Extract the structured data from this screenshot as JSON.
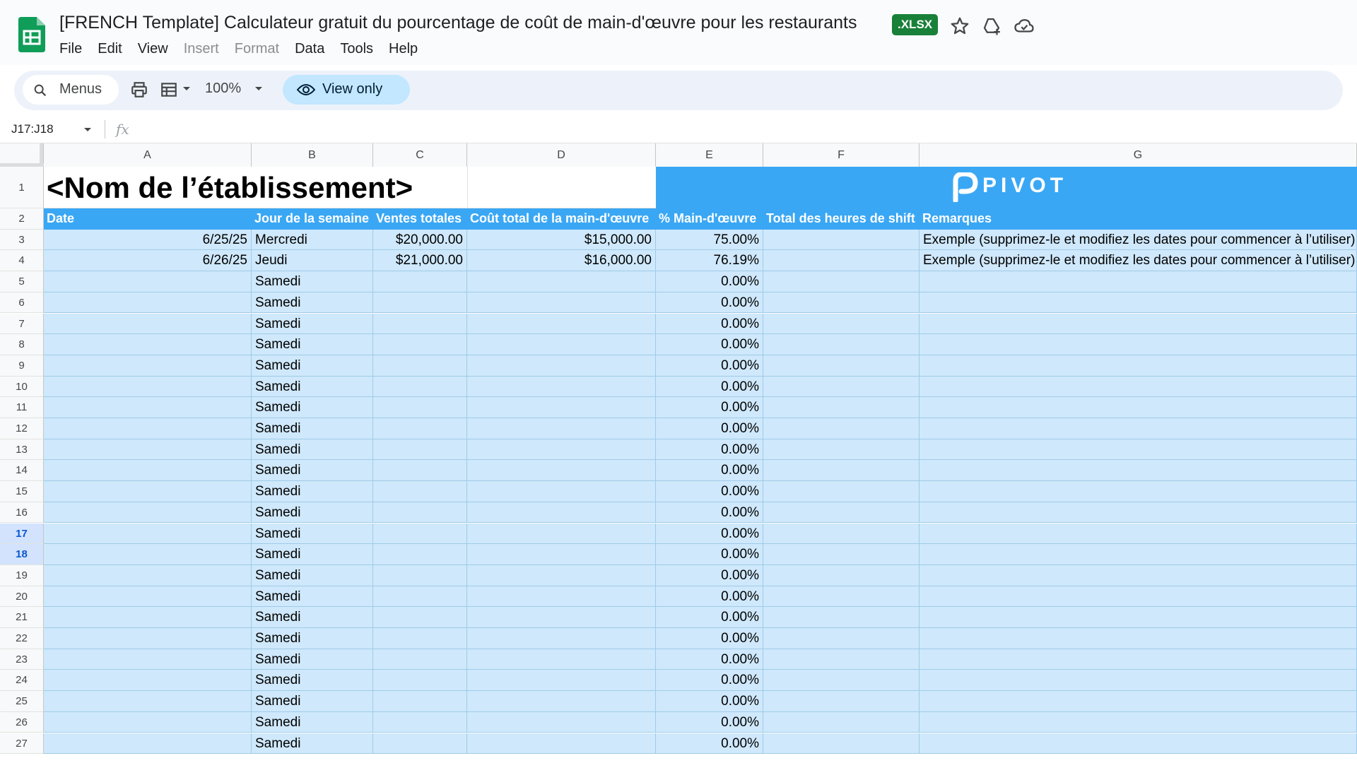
{
  "document": {
    "title": "[FRENCH Template] Calculateur gratuit du pourcentage de coût de main-d'œuvre pour les restaurants",
    "badge": ".XLSX"
  },
  "icons": {
    "app": "sheets-icon",
    "star": "star-icon",
    "move_to_drive": "drive-add-icon",
    "cloud": "cloud-status-icon"
  },
  "menu": [
    "File",
    "Edit",
    "View",
    "Insert",
    "Format",
    "Data",
    "Tools",
    "Help"
  ],
  "menu_disabled": [
    "Insert",
    "Format"
  ],
  "toolbar": {
    "search_label": "Menus",
    "zoom": "100%",
    "view_only_label": "View only"
  },
  "formula_bar": {
    "name_box": "J17:J18",
    "fx": "fx"
  },
  "columns": [
    "A",
    "B",
    "C",
    "D",
    "E",
    "F",
    "G"
  ],
  "sheet": {
    "establishment_name": "<Nom de l’établissement>",
    "brand_name": "PIVOT",
    "headers": [
      "Date",
      "Jour de la semaine",
      "Ventes totales",
      "Coût total de la main-d'œuvre",
      "% Main-d'œuvre",
      "Total des heures de shift",
      "Remarques"
    ],
    "rows": [
      {
        "row": "3",
        "date": "6/25/25",
        "day": "Mercredi",
        "sales": "$20,000.00",
        "labor": "$15,000.00",
        "pct": "75.00%",
        "hours": "",
        "notes": "Exemple (supprimez-le et modifiez les dates pour commencer à l’utiliser)"
      },
      {
        "row": "4",
        "date": "6/26/25",
        "day": "Jeudi",
        "sales": "$21,000.00",
        "labor": "$16,000.00",
        "pct": "76.19%",
        "hours": "",
        "notes": "Exemple (supprimez-le et modifiez les dates pour commencer à l’utiliser)"
      },
      {
        "row": "5",
        "date": "",
        "day": "Samedi",
        "sales": "",
        "labor": "",
        "pct": "0.00%",
        "hours": "",
        "notes": ""
      },
      {
        "row": "6",
        "date": "",
        "day": "Samedi",
        "sales": "",
        "labor": "",
        "pct": "0.00%",
        "hours": "",
        "notes": ""
      },
      {
        "row": "7",
        "date": "",
        "day": "Samedi",
        "sales": "",
        "labor": "",
        "pct": "0.00%",
        "hours": "",
        "notes": ""
      },
      {
        "row": "8",
        "date": "",
        "day": "Samedi",
        "sales": "",
        "labor": "",
        "pct": "0.00%",
        "hours": "",
        "notes": ""
      },
      {
        "row": "9",
        "date": "",
        "day": "Samedi",
        "sales": "",
        "labor": "",
        "pct": "0.00%",
        "hours": "",
        "notes": ""
      },
      {
        "row": "10",
        "date": "",
        "day": "Samedi",
        "sales": "",
        "labor": "",
        "pct": "0.00%",
        "hours": "",
        "notes": ""
      },
      {
        "row": "11",
        "date": "",
        "day": "Samedi",
        "sales": "",
        "labor": "",
        "pct": "0.00%",
        "hours": "",
        "notes": ""
      },
      {
        "row": "12",
        "date": "",
        "day": "Samedi",
        "sales": "",
        "labor": "",
        "pct": "0.00%",
        "hours": "",
        "notes": ""
      },
      {
        "row": "13",
        "date": "",
        "day": "Samedi",
        "sales": "",
        "labor": "",
        "pct": "0.00%",
        "hours": "",
        "notes": ""
      },
      {
        "row": "14",
        "date": "",
        "day": "Samedi",
        "sales": "",
        "labor": "",
        "pct": "0.00%",
        "hours": "",
        "notes": ""
      },
      {
        "row": "15",
        "date": "",
        "day": "Samedi",
        "sales": "",
        "labor": "",
        "pct": "0.00%",
        "hours": "",
        "notes": ""
      },
      {
        "row": "16",
        "date": "",
        "day": "Samedi",
        "sales": "",
        "labor": "",
        "pct": "0.00%",
        "hours": "",
        "notes": ""
      },
      {
        "row": "17",
        "date": "",
        "day": "Samedi",
        "sales": "",
        "labor": "",
        "pct": "0.00%",
        "hours": "",
        "notes": "",
        "selected": true
      },
      {
        "row": "18",
        "date": "",
        "day": "Samedi",
        "sales": "",
        "labor": "",
        "pct": "0.00%",
        "hours": "",
        "notes": "",
        "selected": true
      },
      {
        "row": "19",
        "date": "",
        "day": "Samedi",
        "sales": "",
        "labor": "",
        "pct": "0.00%",
        "hours": "",
        "notes": ""
      },
      {
        "row": "20",
        "date": "",
        "day": "Samedi",
        "sales": "",
        "labor": "",
        "pct": "0.00%",
        "hours": "",
        "notes": ""
      },
      {
        "row": "21",
        "date": "",
        "day": "Samedi",
        "sales": "",
        "labor": "",
        "pct": "0.00%",
        "hours": "",
        "notes": ""
      },
      {
        "row": "22",
        "date": "",
        "day": "Samedi",
        "sales": "",
        "labor": "",
        "pct": "0.00%",
        "hours": "",
        "notes": ""
      },
      {
        "row": "23",
        "date": "",
        "day": "Samedi",
        "sales": "",
        "labor": "",
        "pct": "0.00%",
        "hours": "",
        "notes": ""
      },
      {
        "row": "24",
        "date": "",
        "day": "Samedi",
        "sales": "",
        "labor": "",
        "pct": "0.00%",
        "hours": "",
        "notes": ""
      },
      {
        "row": "25",
        "date": "",
        "day": "Samedi",
        "sales": "",
        "labor": "",
        "pct": "0.00%",
        "hours": "",
        "notes": ""
      },
      {
        "row": "26",
        "date": "",
        "day": "Samedi",
        "sales": "",
        "labor": "",
        "pct": "0.00%",
        "hours": "",
        "notes": ""
      },
      {
        "row": "27",
        "date": "",
        "day": "Samedi",
        "sales": "",
        "labor": "",
        "pct": "0.00%",
        "hours": "",
        "notes": ""
      }
    ],
    "row_header_labels": [
      "1",
      "2"
    ]
  },
  "colors": {
    "header_blue": "#3aa7f5",
    "data_fill": "#cfe8fb",
    "xlsx_green": "#188038",
    "view_only_fill": "#c2e7ff"
  }
}
